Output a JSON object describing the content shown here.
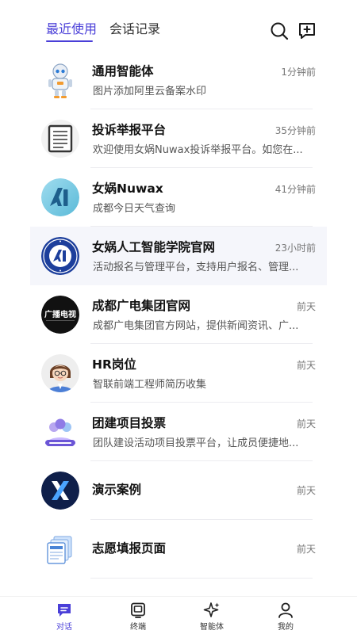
{
  "header": {
    "tabs": [
      {
        "label": "最近使用",
        "active": true
      },
      {
        "label": "会话记录",
        "active": false
      }
    ],
    "accent_color": "#4a3fd8",
    "icons": [
      "search-icon",
      "new-chat-icon"
    ]
  },
  "conversations": [
    {
      "name": "通用智能体",
      "time": "1分钟前",
      "desc": "图片添加阿里云备案水印",
      "avatar": "robot-avatar"
    },
    {
      "name": "投诉举报平台",
      "time": "35分钟前",
      "desc": "欢迎使用女娲Nuwax投诉举报平台。如您在...",
      "avatar": "document-avatar"
    },
    {
      "name": "女娲Nuwax",
      "time": "41分钟前",
      "desc": "成都今日天气查询",
      "avatar": "nuwax-logo-avatar"
    },
    {
      "name": "女娲人工智能学院官网",
      "time": "23小时前",
      "desc": "活动报名与管理平台，支持用户报名、管理...",
      "avatar": "academy-seal-avatar"
    },
    {
      "name": "成都广电集团官网",
      "time": "前天",
      "desc": "成都广电集团官方网站，提供新闻资讯、广...",
      "avatar": "broadcast-logo-avatar"
    },
    {
      "name": "HR岗位",
      "time": "前天",
      "desc": "智联前端工程师简历收集",
      "avatar": "person-avatar"
    },
    {
      "name": "团建项目投票",
      "time": "前天",
      "desc": "团队建设活动项目投票平台，让成员便捷地...",
      "avatar": "team-planner-avatar"
    },
    {
      "name": "演示案例",
      "time": "前天",
      "desc": "",
      "avatar": "x-logo-avatar"
    },
    {
      "name": "志愿填报页面",
      "time": "前天",
      "desc": "",
      "avatar": "pages-stack-avatar"
    }
  ],
  "avatar_texts": {
    "broadcast": "广播电视"
  },
  "tabbar": [
    {
      "label": "对话",
      "icon": "chat-icon",
      "active": true
    },
    {
      "label": "终端",
      "icon": "terminal-icon",
      "active": false
    },
    {
      "label": "智能体",
      "icon": "sparkle-icon",
      "active": false
    },
    {
      "label": "我的",
      "icon": "profile-icon",
      "active": false
    }
  ]
}
